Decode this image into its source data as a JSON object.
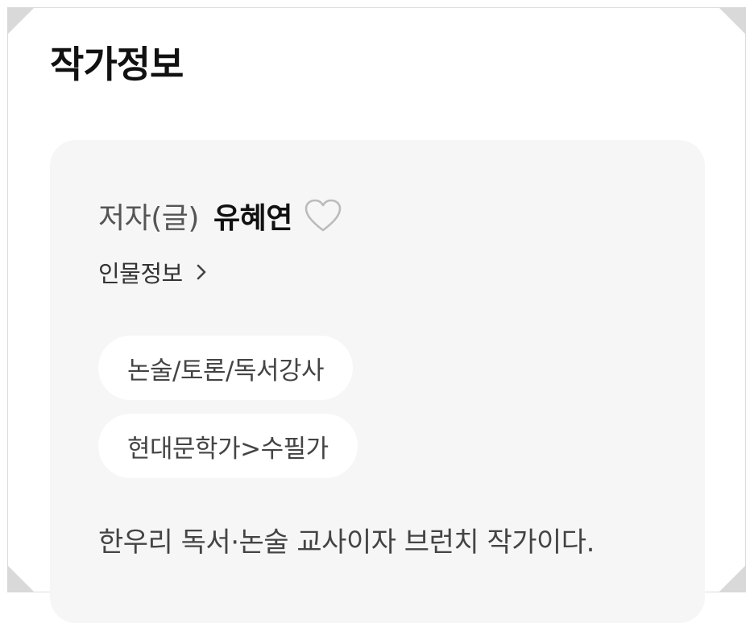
{
  "section": {
    "title": "작가정보"
  },
  "author": {
    "role": "저자(글)",
    "name": "유혜연",
    "favorite_icon": "heart-outline-icon",
    "profile_link_label": "인물정보",
    "profile_link_icon": "chevron-right-icon"
  },
  "tags": [
    {
      "label": "논술/토론/독서강사"
    },
    {
      "label": "현대문학가>수필가"
    }
  ],
  "description": "한우리 독서·논술 교사이자 브런치 작가이다.",
  "colors": {
    "card_background": "#f6f6f6",
    "tag_background": "#ffffff",
    "heart_stroke": "#bbbbbb"
  }
}
